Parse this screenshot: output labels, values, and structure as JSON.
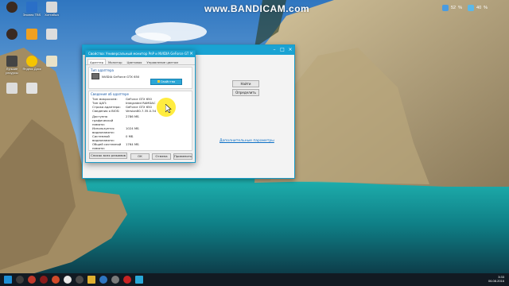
{
  "watermark": "www.BANDICAM.com",
  "system_monitor": {
    "label_a": "52",
    "label_b": "40",
    "unit": "%"
  },
  "desktop_icons": [
    {
      "name": "desktop-icon-1",
      "label": ""
    },
    {
      "name": "desktop-icon-2",
      "label": "Эпопея TBS"
    },
    {
      "name": "desktop-icon-3",
      "label": "Хоттабыч"
    },
    {
      "name": "desktop-icon-4",
      "label": ""
    },
    {
      "name": "desktop-icon-5",
      "label": ""
    },
    {
      "name": "desktop-icon-6",
      "label": ""
    },
    {
      "name": "desktop-icon-7",
      "label": "Лучшие ресурсы"
    },
    {
      "name": "desktop-icon-8",
      "label": "Яндекс Диск"
    },
    {
      "name": "desktop-icon-9",
      "label": ""
    }
  ],
  "back_window": {
    "title": "",
    "find_button": "Найти",
    "detect_button": "Определить",
    "advanced_link": "Дополнительные параметры"
  },
  "dialog": {
    "title": "Свойства: Универсальный монитор PnP и NVIDIA GeForce GT",
    "tabs": [
      "Адаптер",
      "Монитор",
      "Цветовая",
      "Управление цветом"
    ],
    "adapter_type_label": "Тип адаптера",
    "adapter_name": "NVIDIA GeForce GTX 650",
    "properties_button": "Свойства",
    "adapter_info_label": "Сведения об адаптере",
    "info_rows": [
      {
        "k": "Тип микросхем:",
        "v": "GeForce GTX 650"
      },
      {
        "k": "Тип ЦАП:",
        "v": "Integrated RAMDAC"
      },
      {
        "k": "Строка адаптера:",
        "v": "GeForce GTX 650"
      },
      {
        "k": "Сведения о BIOS:",
        "v": "Version80.7.35.0.34"
      },
      {
        "k": "Доступно графической памяти:",
        "v": "2786 MБ"
      },
      {
        "k": "Используется видеопамяти:",
        "v": "1024 MБ"
      },
      {
        "k": "Системной видеопамяти:",
        "v": "0 MБ"
      },
      {
        "k": "Общей системной памяти:",
        "v": "1764 MБ"
      }
    ],
    "list_modes_button": "Список всех режимов",
    "ok_button": "ОК",
    "cancel_button": "Отмена",
    "apply_button": "Применить"
  },
  "taskbar": {
    "time": "3:33",
    "date": "06.08.2016"
  },
  "colors": {
    "accent": "#1aa3d3",
    "taskbar": "#121a22"
  }
}
